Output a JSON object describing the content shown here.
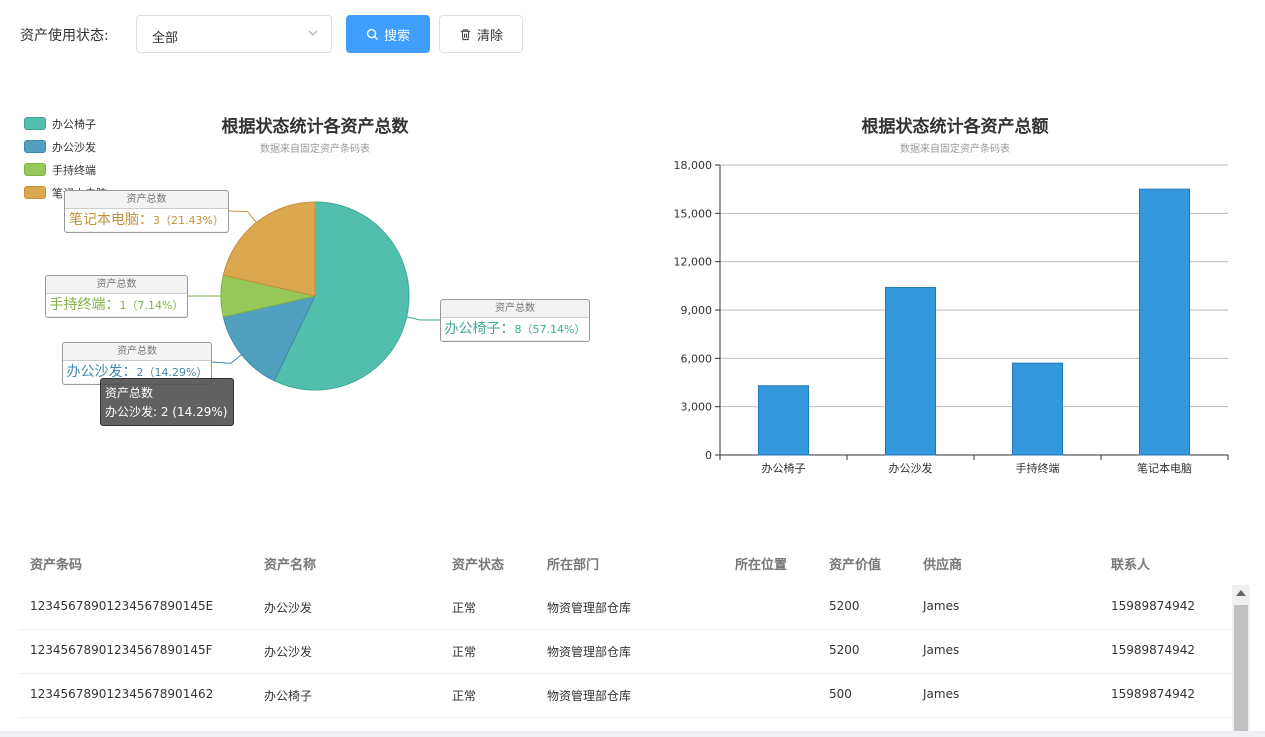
{
  "filter": {
    "label": "资产使用状态:",
    "select_value": "全部",
    "search_label": "搜索",
    "clear_label": "清除"
  },
  "colors": {
    "primary": "#409eff",
    "pie": [
      "#52bfad",
      "#52a0c0",
      "#97c95a",
      "#dba84f"
    ],
    "bar": "#3496db"
  },
  "chart_data": [
    {
      "type": "pie",
      "title": "根据状态统计各资产总数",
      "subtitle": "数据来自固定资产条码表",
      "series_name": "资产总数",
      "legend_position": "top-left",
      "slices": [
        {
          "name": "办公椅子",
          "value": 8,
          "percent": "57.14%"
        },
        {
          "name": "办公沙发",
          "value": 2,
          "percent": "14.29%"
        },
        {
          "name": "手持终端",
          "value": 1,
          "percent": "7.14%"
        },
        {
          "name": "笔记本电脑",
          "value": 3,
          "percent": "21.43%"
        }
      ],
      "tooltip": {
        "title": "资产总数",
        "text": "办公沙发: 2 (14.29%)"
      }
    },
    {
      "type": "bar",
      "title": "根据状态统计各资产总额",
      "subtitle": "数据来自固定资产条码表",
      "categories": [
        "办公椅子",
        "办公沙发",
        "手持终端",
        "笔记本电脑"
      ],
      "values": [
        4300,
        10400,
        5700,
        16500
      ],
      "ylim": [
        0,
        18000
      ],
      "yticks": [
        "0",
        "3,000",
        "6,000",
        "9,000",
        "12,000",
        "15,000",
        "18,000"
      ],
      "grid": true
    }
  ],
  "table": {
    "columns": [
      "资产条码",
      "资产名称",
      "资产状态",
      "所在部门",
      "所在位置",
      "资产价值",
      "供应商",
      "联系人"
    ],
    "rows": [
      [
        "1234567890123456789014​5E",
        "办公沙发",
        "正常",
        "物资管理部仓库",
        "",
        "5200",
        "James",
        "15989874942"
      ],
      [
        "12345678901234567890145F",
        "办公沙发",
        "正常",
        "物资管理部仓库",
        "",
        "5200",
        "James",
        "15989874942"
      ],
      [
        "123456789012345678901462",
        "办公椅子",
        "正常",
        "物资管理部仓库",
        "",
        "500",
        "James",
        "15989874942"
      ]
    ]
  }
}
